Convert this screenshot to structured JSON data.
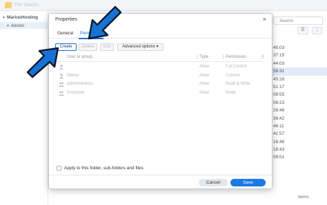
{
  "app": {
    "title": "File Station",
    "tree_root": "MariusHosting",
    "tree_child": "docker",
    "search_label": "Search",
    "list_view_icon": "list-view-icon",
    "more_icon": "more-icon",
    "times": [
      "45:03",
      "37:15",
      "44:03",
      "56:31",
      "45:28",
      "51:17",
      "08:55",
      "06:23",
      "26:48",
      "36:42",
      "46:11",
      "41:57",
      "16:48",
      "18:43",
      "09:51"
    ],
    "selected_time_index": 3,
    "footer_label": "items"
  },
  "dialog": {
    "title": "Properties",
    "tabs": [
      {
        "label": "General",
        "active": false
      },
      {
        "label": "Permission",
        "active": true
      }
    ],
    "toolbar": {
      "create": "Create",
      "delete": "Delete",
      "edit": "Edit",
      "advanced": "Advanced options ▾"
    },
    "columns": {
      "user": "User or group",
      "type": "Type",
      "permission": "Permission",
      "extra": "I"
    },
    "rows": [
      {
        "icon": "user-icon",
        "name": "",
        "type": "Allow",
        "permission": "Full Control"
      },
      {
        "icon": "user-icon",
        "name": "Owner",
        "type": "Allow",
        "permission": "Custom"
      },
      {
        "icon": "group-icon",
        "name": "administrators",
        "type": "Allow",
        "permission": "Read & Write"
      },
      {
        "icon": "group-icon",
        "name": "Everyone",
        "type": "Allow",
        "permission": "Read"
      }
    ],
    "apply_label": "Apply to this folder, sub-folders and files",
    "apply_checked": false,
    "cancel": "Cancel",
    "save": "Save",
    "close_glyph": "×"
  },
  "annotation": {
    "arrow_color": "#1673d6",
    "arrow_outline": "#0d1b2a"
  },
  "colors": {
    "accent": "#1a79e3",
    "selection": "#dbe8f6"
  }
}
